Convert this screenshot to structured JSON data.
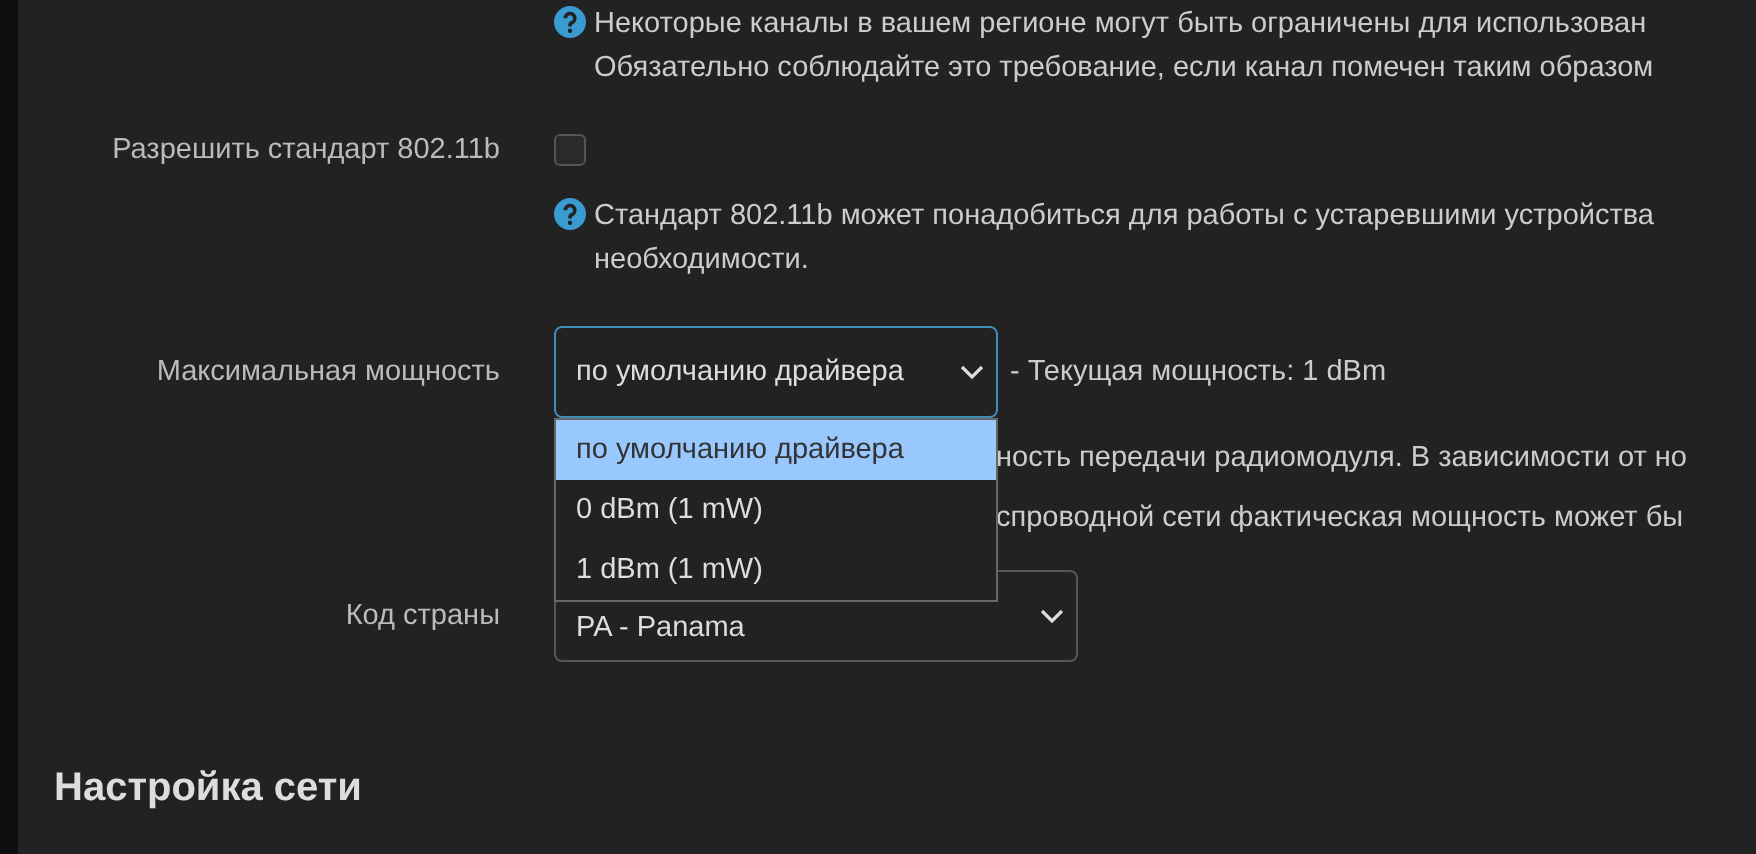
{
  "channel_help": {
    "lines": [
      "Некоторые каналы в вашем регионе могут быть ограничены для использован",
      "Обязательно соблюдайте это требование, если канал помечен таким образом"
    ]
  },
  "allow_80211b": {
    "label": "Разрешить стандарт 802.11b",
    "checked": false,
    "help": [
      "Стандарт 802.11b может понадобиться для работы с устаревшими устройства",
      "необходимости."
    ]
  },
  "max_power": {
    "label": "Максимальная мощность",
    "value": "по умолчанию драйвера",
    "current": "- Текущая мощность: 1 dBm",
    "expanded": true,
    "options": [
      {
        "label": "по умолчанию драйвера",
        "selected": true
      },
      {
        "label": "0 dBm (1 mW)",
        "selected": false
      },
      {
        "label": "1 dBm (1 mW)",
        "selected": false
      }
    ],
    "help": [
      "ность передачи радиомодуля. В зависимости от но",
      "спроводной сети фактическая мощность может бы"
    ]
  },
  "country": {
    "label": "Код страны",
    "value": "PA - Panama"
  },
  "section_heading": "Настройка сети"
}
